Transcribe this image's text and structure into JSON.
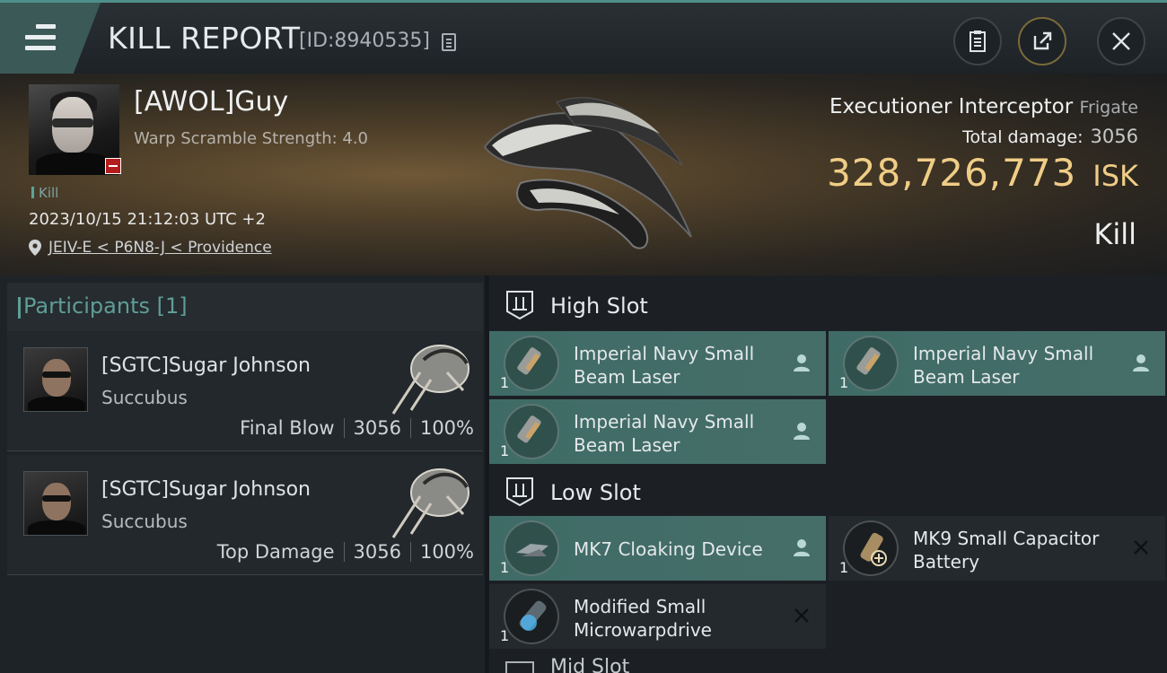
{
  "header": {
    "title": "KILL REPORT",
    "report_id": "[ID:8940535]"
  },
  "victim": {
    "name": "[AWOL]Guy",
    "warp_scramble": "Warp Scramble Strength: 4.0",
    "tag": "Kill",
    "timestamp": "2023/10/15 21:12:03 UTC +2",
    "location": "JEIV-E < P6N8-J < Providence",
    "ship_name": "Executioner Interceptor",
    "ship_class": "Frigate",
    "total_damage_label": "Total damage:",
    "total_damage": "3056",
    "isk_value": "328,726,773",
    "isk_unit": "ISK",
    "result": "Kill"
  },
  "participants": {
    "title": "Participants [1]",
    "rows": [
      {
        "name": "[SGTC]Sugar Johnson",
        "ship": "Succubus",
        "role": "Final Blow",
        "damage": "3056",
        "percent": "100%"
      },
      {
        "name": "[SGTC]Sugar Johnson",
        "ship": "Succubus",
        "role": "Top Damage",
        "damage": "3056",
        "percent": "100%"
      }
    ]
  },
  "slots": {
    "high": {
      "label": "High Slot",
      "modules": [
        {
          "name": "Imperial Navy Small Beam Laser",
          "qty": "1",
          "status": "fitted"
        },
        {
          "name": "Imperial Navy Small Beam Laser",
          "qty": "1",
          "status": "fitted"
        },
        {
          "name": "Imperial Navy Small Beam Laser",
          "qty": "1",
          "status": "fitted"
        }
      ]
    },
    "low": {
      "label": "Low Slot",
      "modules": [
        {
          "name": "MK7 Cloaking Device",
          "qty": "1",
          "status": "fitted"
        },
        {
          "name": "MK9 Small Capacitor Battery",
          "qty": "1",
          "status": "destroyed"
        },
        {
          "name": "Modified Small Microwarpdrive",
          "qty": "1",
          "status": "destroyed"
        }
      ]
    },
    "mid": {
      "label": "Mid Slot"
    }
  },
  "icons": {
    "menu": "hamburger-menu-icon",
    "copy": "copy-icon",
    "clipboard": "clipboard-icon",
    "share": "share-icon",
    "close": "close-icon",
    "location": "location-pin-icon",
    "fitted": "person-icon",
    "destroyed": "x-mark-icon"
  },
  "colors": {
    "accent": "#4f8f89",
    "isk": "#f0cd86",
    "fitted_bg": "#466e69",
    "destroyed_badge": "#b51c1c"
  }
}
